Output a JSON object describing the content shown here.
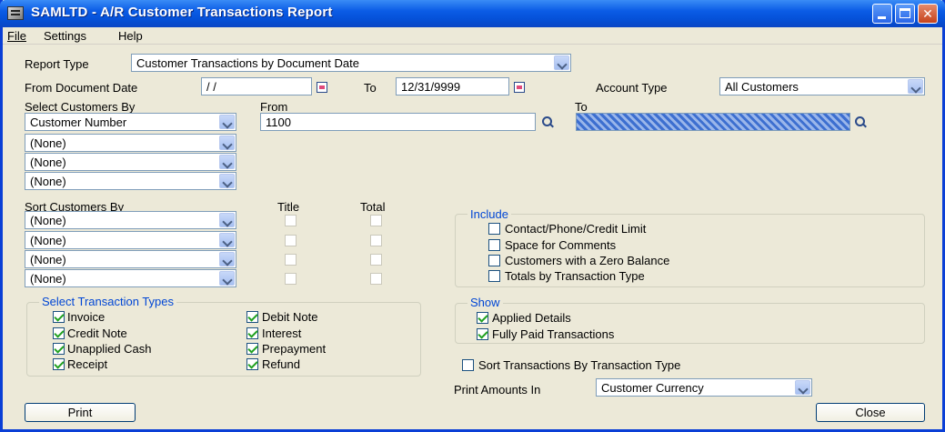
{
  "window": {
    "title": "SAMLTD - A/R Customer Transactions Report"
  },
  "menu": {
    "file": "File",
    "settings": "Settings",
    "help": "Help"
  },
  "report_type": {
    "label": "Report Type",
    "value": "Customer Transactions by Document Date"
  },
  "document_date": {
    "from_label": "From Document Date",
    "from_value": "/ /",
    "to_label": "To",
    "to_value": "12/31/9999"
  },
  "account_type": {
    "label": "Account Type",
    "value": "All Customers"
  },
  "select_by": {
    "label": "Select Customers By",
    "from_label": "From",
    "to_label": "To",
    "rows": [
      {
        "field": "Customer Number",
        "from": "1100",
        "to": ""
      },
      {
        "field": "(None)"
      },
      {
        "field": "(None)"
      },
      {
        "field": "(None)"
      }
    ]
  },
  "sort_by": {
    "label": "Sort Customers By",
    "title_label": "Title",
    "total_label": "Total",
    "rows": [
      {
        "field": "(None)"
      },
      {
        "field": "(None)"
      },
      {
        "field": "(None)"
      },
      {
        "field": "(None)"
      }
    ]
  },
  "include": {
    "title": "Include",
    "items": [
      {
        "label": "Contact/Phone/Credit Limit",
        "checked": false
      },
      {
        "label": "Space for Comments",
        "checked": false
      },
      {
        "label": "Customers with a Zero Balance",
        "checked": false
      },
      {
        "label": "Totals by Transaction Type",
        "checked": false
      }
    ]
  },
  "transaction_types": {
    "title": "Select Transaction Types",
    "left": [
      {
        "label": "Invoice",
        "checked": true
      },
      {
        "label": "Credit Note",
        "checked": true
      },
      {
        "label": "Unapplied Cash",
        "checked": true
      },
      {
        "label": "Receipt",
        "checked": true
      }
    ],
    "right": [
      {
        "label": "Debit Note",
        "checked": true
      },
      {
        "label": "Interest",
        "checked": true
      },
      {
        "label": "Prepayment",
        "checked": true
      },
      {
        "label": "Refund",
        "checked": true
      }
    ]
  },
  "show": {
    "title": "Show",
    "items": [
      {
        "label": "Applied Details",
        "checked": true
      },
      {
        "label": "Fully Paid Transactions",
        "checked": true
      }
    ]
  },
  "sort_transactions": {
    "label": "Sort Transactions By Transaction Type",
    "checked": false
  },
  "print_amounts": {
    "label": "Print Amounts In",
    "value": "Customer Currency"
  },
  "buttons": {
    "print": "Print",
    "close": "Close"
  },
  "colors": {
    "titlebar": "#0b5ce6",
    "group_title": "#0046d5",
    "check": "#21a121"
  }
}
